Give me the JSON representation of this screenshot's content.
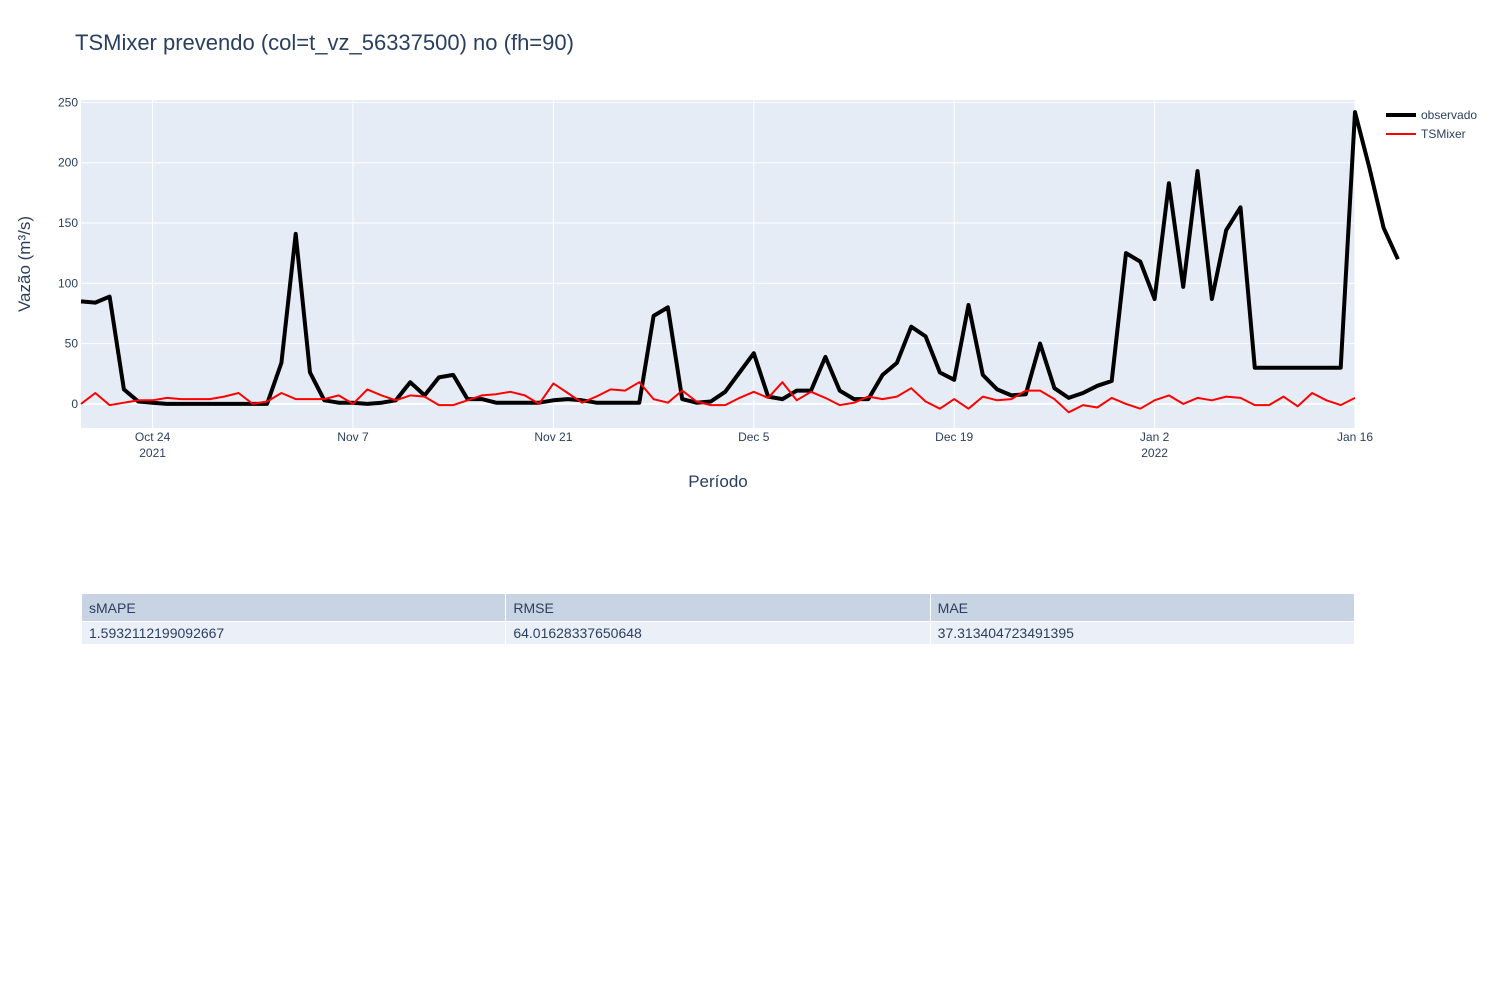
{
  "chart_data": {
    "type": "line",
    "title": "TSMixer prevendo (col=t_vz_56337500) no (fh=90)",
    "xlabel": "Período",
    "ylabel": "Vazão (m³/s)",
    "x_start": "2021-10-19",
    "x_end": "2022-01-16",
    "ylim": [
      -20,
      252
    ],
    "y_ticks": [
      0,
      50,
      100,
      150,
      200,
      250
    ],
    "x_ticks": [
      {
        "date": "2021-10-24",
        "label": "Oct 24",
        "sub": "2021"
      },
      {
        "date": "2021-11-07",
        "label": "Nov 7",
        "sub": ""
      },
      {
        "date": "2021-11-21",
        "label": "Nov 21",
        "sub": ""
      },
      {
        "date": "2021-12-05",
        "label": "Dec 5",
        "sub": ""
      },
      {
        "date": "2021-12-19",
        "label": "Dec 19",
        "sub": ""
      },
      {
        "date": "2022-01-02",
        "label": "Jan 2",
        "sub": "2022"
      },
      {
        "date": "2022-01-16",
        "label": "Jan 16",
        "sub": ""
      }
    ],
    "grid": true,
    "legend_position": "top-right",
    "series": [
      {
        "name": "observado",
        "color": "#000000",
        "values": [
          85,
          84,
          89,
          12,
          2,
          1,
          0,
          0,
          0,
          0,
          0,
          0,
          0,
          0,
          34,
          141,
          26,
          3,
          1,
          1,
          0,
          1,
          3,
          18,
          7,
          22,
          24,
          4,
          4,
          1,
          1,
          1,
          1,
          3,
          4,
          3,
          1,
          1,
          1,
          1,
          73,
          80,
          4,
          1,
          2,
          10,
          26,
          42,
          6,
          4,
          11,
          11,
          39,
          11,
          4,
          4,
          24,
          34,
          64,
          56,
          26,
          20,
          82,
          24,
          12,
          7,
          8,
          50,
          13,
          5,
          9,
          15,
          19,
          125,
          118,
          87,
          183,
          97,
          193,
          87,
          144,
          163,
          30,
          30,
          30,
          30,
          30,
          30,
          30,
          242,
          196,
          146,
          120
        ]
      },
      {
        "name": "TSMixer",
        "color": "#ff0000",
        "values": [
          0,
          9,
          -1,
          1,
          3,
          3,
          5,
          4,
          4,
          4,
          6,
          9,
          0,
          2,
          9,
          4,
          4,
          4,
          7,
          0,
          12,
          7,
          3,
          7,
          6,
          -1,
          -1,
          3,
          7,
          8,
          10,
          7,
          0,
          17,
          9,
          1,
          6,
          12,
          11,
          18,
          4,
          1,
          11,
          2,
          -1,
          -1,
          5,
          10,
          5,
          18,
          3,
          10,
          5,
          -1,
          1,
          6,
          4,
          6,
          13,
          2,
          -4,
          4,
          -4,
          6,
          3,
          4,
          11,
          11,
          4,
          -7,
          -1,
          -3,
          5,
          0,
          -4,
          3,
          7,
          0,
          5,
          3,
          6,
          5,
          -1,
          -1,
          6,
          -2,
          9,
          3,
          -1,
          5
        ]
      }
    ]
  },
  "table": {
    "headers": [
      "sMAPE",
      "RMSE",
      "MAE"
    ],
    "rows": [
      [
        "1.5932112199092667",
        "64.01628337650648",
        "37.313404723491395"
      ]
    ]
  }
}
